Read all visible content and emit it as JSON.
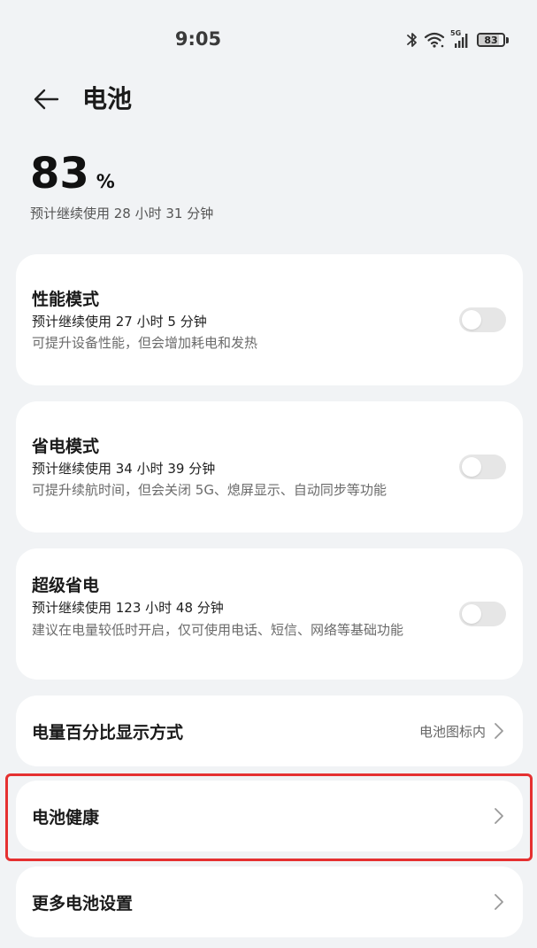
{
  "status_bar": {
    "time": "9:05",
    "signal_label": "5G",
    "battery_level": "83",
    "battery_fraction": 0.83,
    "icons": [
      "bluetooth-icon",
      "wifi-icon",
      "cellular-signal-icon",
      "battery-icon"
    ]
  },
  "header": {
    "back_icon": "arrow-left-icon",
    "title": "电池"
  },
  "battery": {
    "level": "83",
    "unit": "%",
    "remaining": "预计继续使用 28 小时 31 分钟"
  },
  "modes": [
    {
      "title": "性能模式",
      "estimate": "预计继续使用 27 小时 5 分钟",
      "description": "可提升设备性能，但会增加耗电和发热",
      "enabled": false
    },
    {
      "title": "省电模式",
      "estimate": "预计继续使用 34 小时 39 分钟",
      "description": "可提升续航时间，但会关闭 5G、熄屏显示、自动同步等功能",
      "enabled": false
    },
    {
      "title": "超级省电",
      "estimate": "预计继续使用 123 小时 48 分钟",
      "description": "建议在电量较低时开启，仅可使用电话、短信、网络等基础功能",
      "enabled": false
    }
  ],
  "settings": [
    {
      "title": "电量百分比显示方式",
      "value": "电池图标内",
      "icon": "chevron-right-icon"
    },
    {
      "title": "电池健康",
      "value": "",
      "icon": "chevron-right-icon",
      "highlighted": true
    },
    {
      "title": "更多电池设置",
      "value": "",
      "icon": "chevron-right-icon"
    }
  ],
  "colors": {
    "background": "#f1f3f5",
    "card": "#ffffff",
    "highlight": "#e53030",
    "toggle_off": "#e6e6e6"
  }
}
